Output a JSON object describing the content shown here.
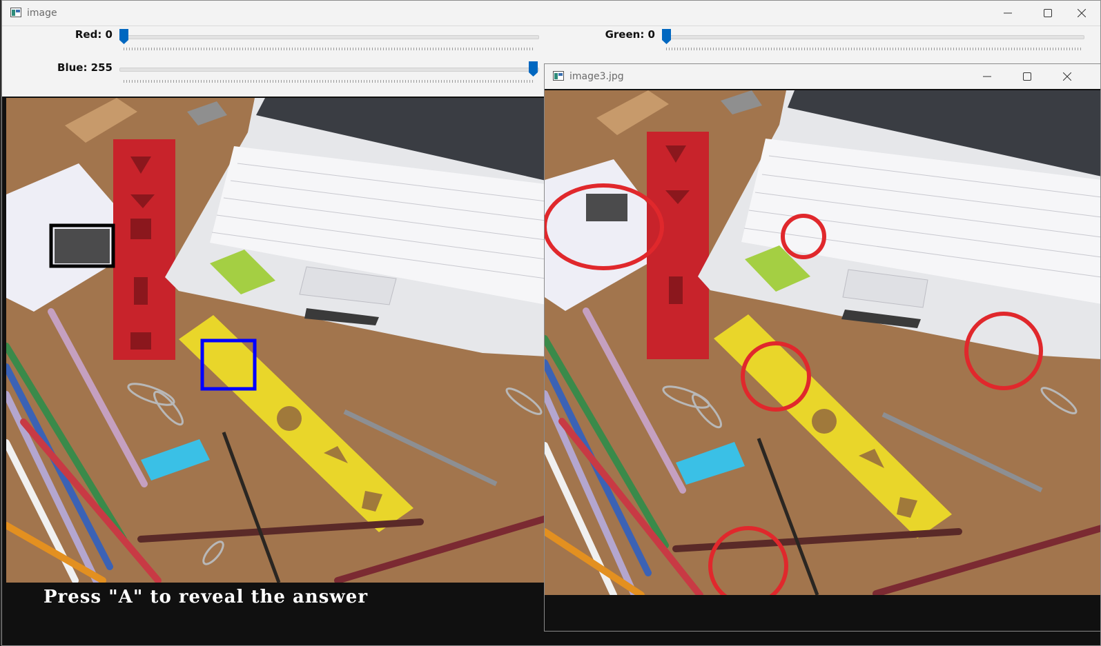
{
  "windows": {
    "main": {
      "title": "image",
      "trackbars": {
        "red": {
          "label": "Red: 0",
          "value": 0,
          "max": 255
        },
        "green": {
          "label": "Green: 0",
          "value": 0,
          "max": 255
        },
        "blue": {
          "label": "Blue: 255",
          "value": 255,
          "max": 255
        }
      },
      "caption": "Press \"A\" to reveal the answer",
      "marker_colors": {
        "black_box": "#000000",
        "blue_box": "#0000ff"
      }
    },
    "answer": {
      "title": "image3.jpg",
      "marker_color": "#e0282c"
    }
  },
  "accent": "#0067c0",
  "icons": [
    "app-icon",
    "minimize-icon",
    "maximize-icon",
    "close-icon"
  ]
}
